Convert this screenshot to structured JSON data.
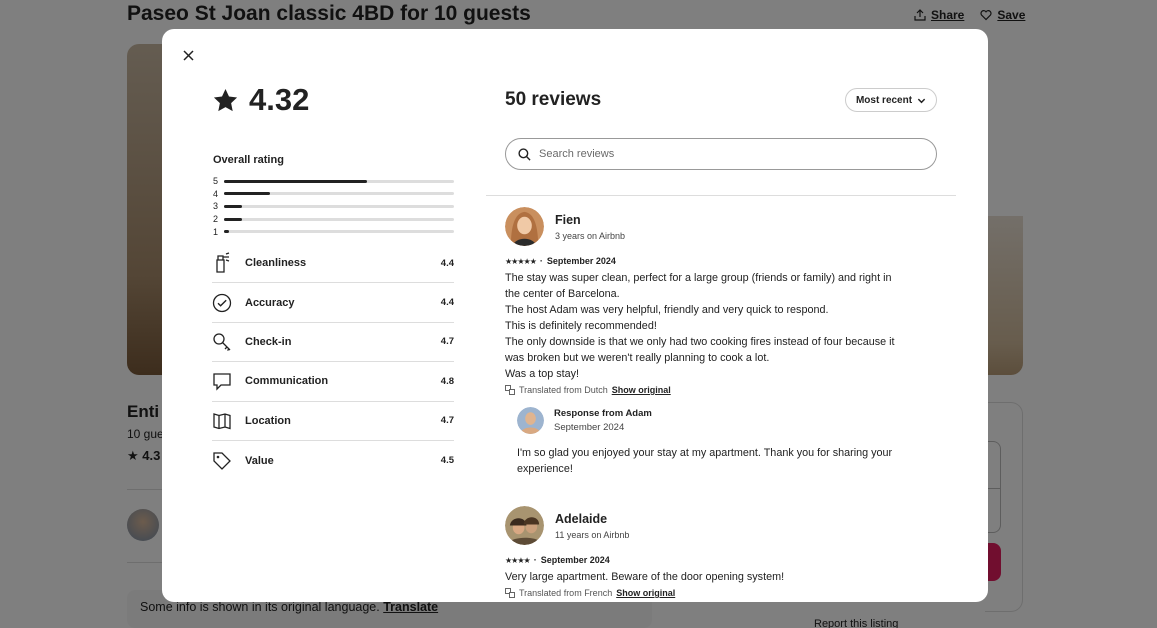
{
  "background": {
    "title": "Paseo St Joan classic 4BD for 10 guests",
    "share_label": "Share",
    "save_label": "Save",
    "entire_fragment": "Enti",
    "guests_fragment": "10 gue",
    "rating_fragment": "4.3",
    "info_text": "Some info is shown in its original language.",
    "translate_link": "Translate",
    "report_label": "Report this listing"
  },
  "modal": {
    "overall_score": "4.32",
    "overall_label": "Overall rating",
    "distribution": [
      {
        "stars": "5",
        "fraction": 0.62
      },
      {
        "stars": "4",
        "fraction": 0.2
      },
      {
        "stars": "3",
        "fraction": 0.08
      },
      {
        "stars": "2",
        "fraction": 0.08
      },
      {
        "stars": "1",
        "fraction": 0.02
      }
    ],
    "categories": [
      {
        "name": "Cleanliness",
        "value": "4.4",
        "icon": "spray-bottle-icon"
      },
      {
        "name": "Accuracy",
        "value": "4.4",
        "icon": "check-circle-icon"
      },
      {
        "name": "Check-in",
        "value": "4.7",
        "icon": "key-icon"
      },
      {
        "name": "Communication",
        "value": "4.8",
        "icon": "chat-bubble-icon"
      },
      {
        "name": "Location",
        "value": "4.7",
        "icon": "map-icon"
      },
      {
        "name": "Value",
        "value": "4.5",
        "icon": "tag-icon"
      }
    ],
    "reviews_title": "50 reviews",
    "sort_label": "Most recent",
    "search_placeholder": "Search reviews",
    "reviews": [
      {
        "name": "Fien",
        "meta": "3 years on Airbnb",
        "stars": "★★★★★",
        "date": "September 2024",
        "lines": [
          "The stay was super clean, perfect for a large group (friends or family) and right in",
          "the center of Barcelona.",
          "The host Adam was very helpful, friendly and very quick to respond.",
          "This is definitely recommended!",
          "The only downside is that we only had two cooking fires instead of four because it",
          "was broken but we weren't really planning to cook a lot.",
          "Was a top stay!"
        ],
        "translated": "Translated from Dutch",
        "show_original": "Show original",
        "response": {
          "name": "Response from Adam",
          "date": "September 2024",
          "lines": [
            "I'm so glad you enjoyed your stay at my apartment. Thank you for sharing your",
            "experience!"
          ]
        }
      },
      {
        "name": "Adelaide",
        "meta": "11 years on Airbnb",
        "stars": "★★★★",
        "date": "September 2024",
        "lines": [
          "Very large apartment. Beware of the door opening system!"
        ],
        "translated": "Translated from French",
        "show_original": "Show original"
      }
    ]
  },
  "colors": {
    "accent": "#e31c5f",
    "text": "#222222",
    "border": "#dddddd"
  }
}
